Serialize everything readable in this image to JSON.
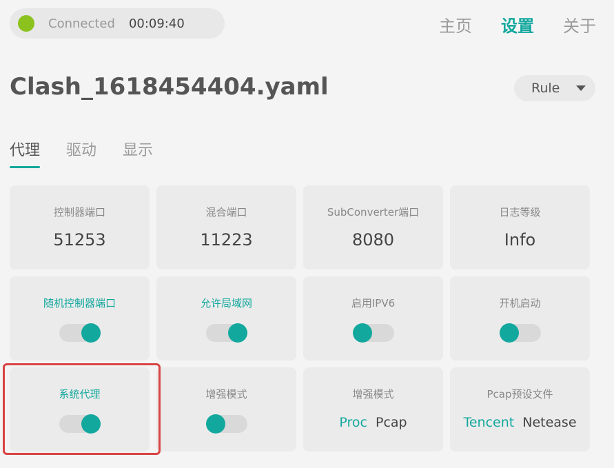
{
  "status": {
    "text": "Connected",
    "time": "00:09:40",
    "dot_color": "#8cc21e"
  },
  "nav": {
    "items": [
      {
        "label": "主页"
      },
      {
        "label": "设置"
      },
      {
        "label": "关于"
      }
    ],
    "active_index": 1
  },
  "config": {
    "filename": "Clash_1618454404.yaml"
  },
  "mode_select": {
    "value": "Rule"
  },
  "tabs": {
    "items": [
      {
        "label": "代理"
      },
      {
        "label": "驱动"
      },
      {
        "label": "显示"
      }
    ],
    "active_index": 0
  },
  "cards": {
    "controller_port": {
      "label": "控制器端口",
      "value": "51253"
    },
    "mixed_port": {
      "label": "混合端口",
      "value": "11223"
    },
    "subconverter_port": {
      "label": "SubConverter端口",
      "value": "8080"
    },
    "log_level": {
      "label": "日志等级",
      "value": "Info"
    },
    "random_controller_port": {
      "label": "随机控制器端口",
      "on": true
    },
    "allow_lan": {
      "label": "允许局域网",
      "on": true
    },
    "enable_ipv6": {
      "label": "启用IPV6",
      "on": false
    },
    "auto_start": {
      "label": "开机启动",
      "on": false
    },
    "system_proxy": {
      "label": "系统代理",
      "on": true
    },
    "enhance_mode_toggle": {
      "label": "增强模式",
      "on": false
    },
    "enhance_mode": {
      "label": "增强模式",
      "options": [
        "Proc",
        "Pcap"
      ],
      "selected": "Proc"
    },
    "pcap_preset": {
      "label": "Pcap预设文件",
      "options": [
        "Tencent",
        "Netease"
      ],
      "selected": "Tencent"
    }
  },
  "colors": {
    "accent": "#13a89e",
    "highlight": "#d94343"
  }
}
